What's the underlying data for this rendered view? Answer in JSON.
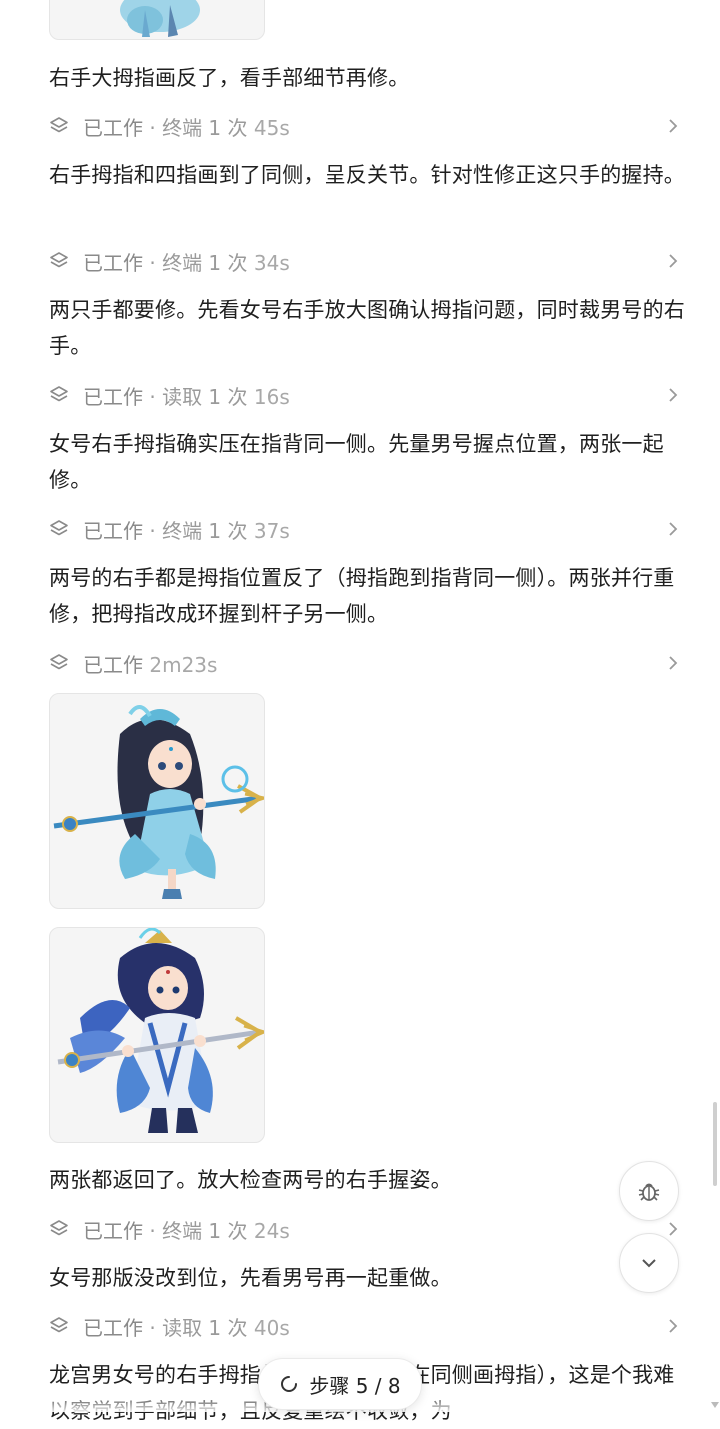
{
  "messages": [
    "右手大拇指画反了，看手部细节再修。",
    "右手拇指和四指画到了同侧，呈反关节。针对性修正这只手的握持。",
    "两只手都要修。先看女号右手放大图确认拇指问题，同时裁男号的右手。",
    "女号右手拇指确实压在指背同一侧。先量男号握点位置，两张一起修。",
    "两号的右手都是拇指位置反了（拇指跑到指背同一侧）。两张并行重修，把拇指改成环握到杆子另一侧。",
    "两张都返回了。放大检查两号的右手握姿。",
    "女号那版没改到位，先看男号再一起重做。",
    "龙宫男女号的右手拇指修好（模型坚持在同侧画拇指），这是个我难以察觉到手部细节，且反复重绘不收敛，为"
  ],
  "steps": [
    {
      "status": "已工作",
      "detail": " · 终端 1 次 ",
      "duration": "45s"
    },
    {
      "status": "已工作",
      "detail": " · 终端 1 次 ",
      "duration": "34s"
    },
    {
      "status": "已工作",
      "detail": " · 读取 1 次 ",
      "duration": "16s"
    },
    {
      "status": "已工作",
      "detail": " · 终端 1 次 ",
      "duration": "37s"
    },
    {
      "status": "已工作",
      "detail": " ",
      "duration": "2m23s"
    },
    {
      "status": "已工作",
      "detail": " · 终端 1 次 ",
      "duration": "24s"
    },
    {
      "status": "已工作",
      "detail": " · 读取 1 次 ",
      "duration": "40s"
    }
  ],
  "images": [
    {
      "icon": "female-character-thumbnail-icon"
    },
    {
      "icon": "female-character-trident-image-icon"
    },
    {
      "icon": "male-character-trident-image-icon"
    }
  ],
  "step_indicator": {
    "label": "步骤 5 / 8"
  },
  "buttons": {
    "debug_icon": "bug-icon",
    "scroll_down_icon": "chevron-down-icon"
  },
  "colors": {
    "muted": "#9a9a9a",
    "text": "#1f1f1f",
    "thumb_bg": "#f5f5f5"
  }
}
